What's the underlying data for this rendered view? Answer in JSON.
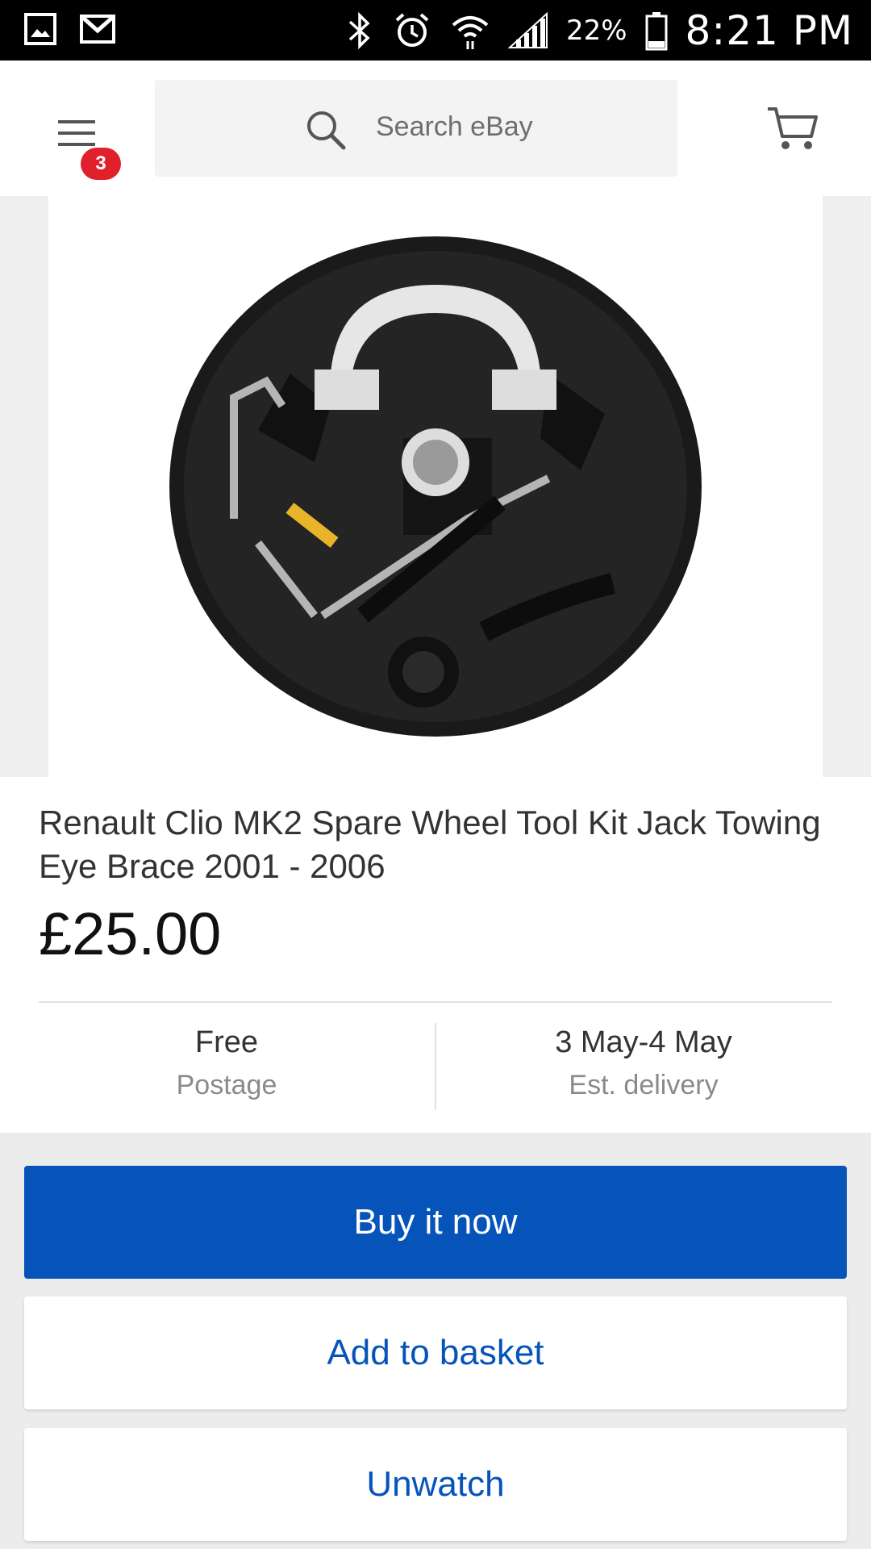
{
  "status_bar": {
    "battery": "22%",
    "time": "8:21 PM",
    "icons": [
      "gallery-icon",
      "gmail-icon",
      "bluetooth-icon",
      "alarm-icon",
      "wifi-icon",
      "signal-icon",
      "battery-icon"
    ]
  },
  "header": {
    "menu_badge": "3",
    "search_placeholder": "Search eBay",
    "icons": [
      "menu-icon",
      "search-icon",
      "cart-icon"
    ]
  },
  "listing": {
    "title": "Renault Clio MK2 Spare Wheel Tool Kit Jack Towing Eye Brace 2001 - 2006",
    "price": "£25.00",
    "postage": {
      "value": "Free",
      "label": "Postage"
    },
    "delivery": {
      "value": "3 May-4 May",
      "label": "Est. delivery"
    }
  },
  "actions": {
    "buy_now": "Buy it now",
    "add_to_basket": "Add to basket",
    "unwatch": "Unwatch"
  },
  "colors": {
    "accent": "#0654ba",
    "badge": "#e0212b"
  }
}
